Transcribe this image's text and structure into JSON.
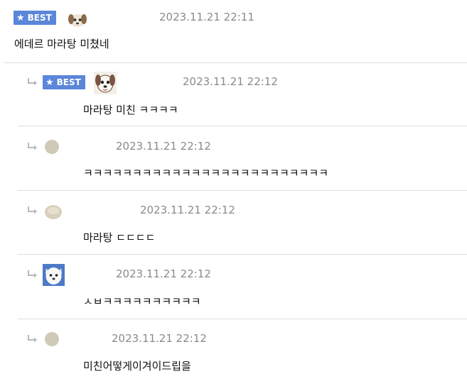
{
  "comments": [
    {
      "badge": "BEST",
      "date": "2023.11.21 22:11",
      "text": "에데르 마라탕 미쳤네",
      "avatar": "puppy-avatar-icon"
    },
    {
      "badge": "BEST",
      "date": "2023.11.21 22:12",
      "text": "마라탕 미친 ㅋㅋㅋㅋ",
      "avatar": "dog-face-avatar-icon"
    },
    {
      "date": "2023.11.21 22:12",
      "text": "ㅋㅋㅋㅋㅋㅋㅋㅋㅋㅋㅋㅋㅋㅋㅋㅋㅋㅋㅋㅋㅋㅋㅋㅋㅋ",
      "avatar": "default-avatar-icon"
    },
    {
      "date": "2023.11.21 22:12",
      "text": "마라탕 ㄷㄷㄷㄷ",
      "avatar": "blob-avatar-icon"
    },
    {
      "date": "2023.11.21 22:12",
      "text": "ㅅㅂㅋㅋㅋㅋㅋㅋㅋㅋㅋㅋ",
      "avatar": "white-dog-avatar-icon"
    },
    {
      "date": "2023.11.21 22:12",
      "text": "미친어떻게이겨이드립을",
      "avatar": "default-avatar-icon"
    }
  ],
  "colors": {
    "badge": "#5b86d9",
    "date": "#8a8a8a",
    "divider": "#dedede",
    "reply_arrow": "#b9b9b9"
  },
  "icons": {
    "badge": "star-icon",
    "reply": "reply-arrow-icon"
  }
}
